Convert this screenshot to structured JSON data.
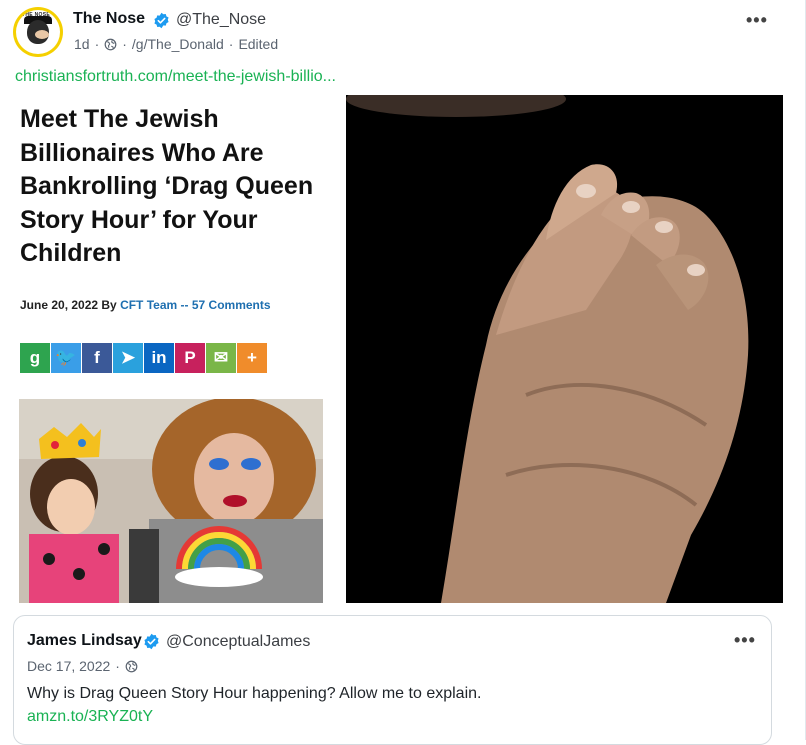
{
  "post": {
    "author_name": "The Nose",
    "author_handle": "@The_Nose",
    "time": "1d",
    "separator": "·",
    "community": "/g/The_Donald",
    "edited": "Edited",
    "more": "•••",
    "link_text": "christiansfortruth.com/meet-the-jewish-billio...",
    "avatar_text": "THE NOSE"
  },
  "article": {
    "headline": "Meet The Jewish Billionaires Who Are Bankrolling ‘Drag Queen Story Hour’ for Your Children",
    "date_by": "June 20, 2022 By ",
    "author": "CFT Team",
    "dash": " -- ",
    "comments": "57 Comments",
    "share_buttons": [
      {
        "icon": "gettr-icon",
        "glyph": "g",
        "color": "#2ea44f"
      },
      {
        "icon": "twitter-icon",
        "glyph": "🐦",
        "color": "#3a9ee8"
      },
      {
        "icon": "facebook-icon",
        "glyph": "f",
        "color": "#3b5998"
      },
      {
        "icon": "telegram-icon",
        "glyph": "➤",
        "color": "#2aa1dd"
      },
      {
        "icon": "linkedin-icon",
        "glyph": "in",
        "color": "#0a66c2"
      },
      {
        "icon": "parler-icon",
        "glyph": "P",
        "color": "#c7215d"
      },
      {
        "icon": "email-icon",
        "glyph": "✉",
        "color": "#7ab648"
      },
      {
        "icon": "more-share-icon",
        "glyph": "+",
        "color": "#f08c2b"
      }
    ]
  },
  "quote": {
    "author_name": "James Lindsay",
    "author_handle": "@ConceptualJames",
    "date": "Dec 17, 2022",
    "separator": "·",
    "more": "•••",
    "text": "Why is Drag Queen Story Hour happening? Allow me to explain.",
    "link": "amzn.to/3RYZ0tY"
  },
  "colors": {
    "link": "#1ab254",
    "verified": "#1d9bf0",
    "byline_blue": "#1e6fb0"
  }
}
